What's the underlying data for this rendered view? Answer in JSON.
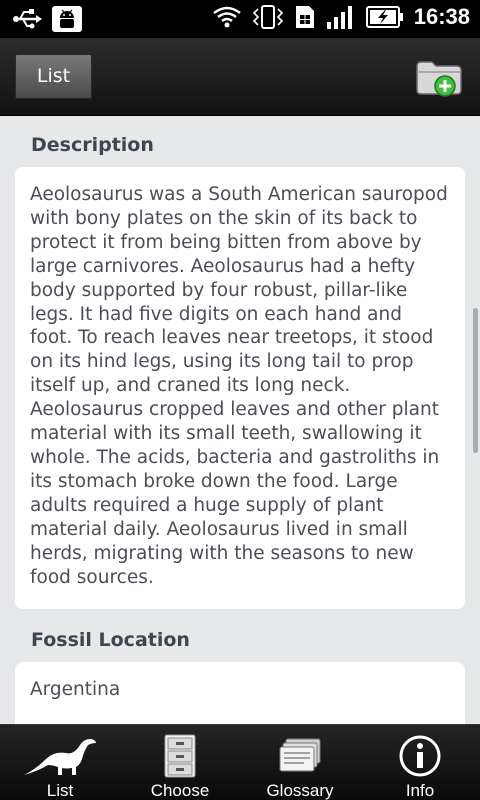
{
  "status_bar": {
    "time": "16:38",
    "icons": [
      "usb-icon",
      "android-debug-icon",
      "wifi-icon",
      "vibrate-icon",
      "sim-icon",
      "signal-icon",
      "battery-charging-icon"
    ]
  },
  "action_bar": {
    "list_label": "List",
    "add_icon": "add-folder-icon"
  },
  "sections": {
    "description": {
      "heading": "Description",
      "text": "Aeolosaurus was a South American sauropod with bony plates on the skin of its back to protect it from being bitten from above by large carnivores. Aeolosaurus had a hefty body supported by four robust, pillar-like legs. It had five digits on each hand and foot. To reach leaves near treetops, it stood on its hind legs, using its long tail to prop itself up, and craned its long neck. Aeolosaurus cropped leaves and other plant material with its small teeth, swallowing it whole. The acids, bacteria and gastroliths in its stomach broke down the food. Large adults required a huge supply of plant material daily. Aeolosaurus lived in small herds, migrating with the seasons to new food sources."
    },
    "fossil_location": {
      "heading": "Fossil Location",
      "text": "Argentina"
    }
  },
  "tabs": [
    {
      "label": "List",
      "icon": "dinosaur-icon"
    },
    {
      "label": "Choose",
      "icon": "cabinet-icon"
    },
    {
      "label": "Glossary",
      "icon": "cards-icon"
    },
    {
      "label": "Info",
      "icon": "info-icon"
    }
  ],
  "colors": {
    "background": "#e7e8ea",
    "heading": "#3e4656",
    "text": "#4a4e57",
    "add_badge": "#3fbf3f"
  }
}
